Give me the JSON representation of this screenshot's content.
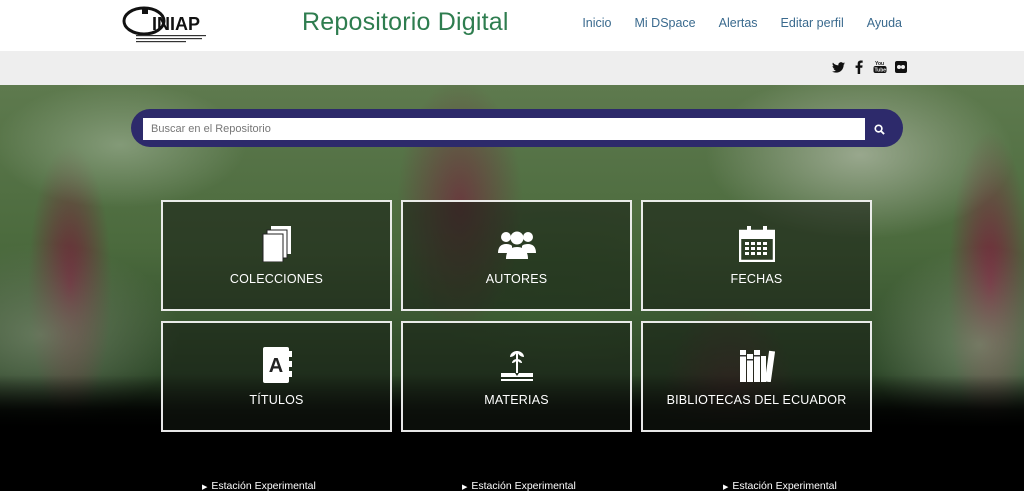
{
  "header": {
    "logo_text": "INIAP",
    "logo_subtitle": "INSTITUTO NACIONAL DE INVESTIGACIONES AGROPECUARIAS",
    "site_title": "Repositorio Digital",
    "nav": [
      "Inicio",
      "Mi DSpace",
      "Alertas",
      "Editar perfil",
      "Ayuda"
    ]
  },
  "social": [
    "twitter-icon",
    "facebook-icon",
    "youtube-icon",
    "flickr-icon"
  ],
  "search": {
    "placeholder": "Buscar en el Repositorio",
    "value": ""
  },
  "tiles": [
    {
      "label": "COLECCIONES",
      "icon": "documents-icon"
    },
    {
      "label": "AUTORES",
      "icon": "users-icon"
    },
    {
      "label": "FECHAS",
      "icon": "calendar-icon"
    },
    {
      "label": "TÍTULOS",
      "icon": "address-book-icon"
    },
    {
      "label": "MATERIAS",
      "icon": "plant-book-icon"
    },
    {
      "label": "BIBLIOTECAS DEL ECUADOR",
      "icon": "library-books-icon"
    }
  ],
  "footer": [
    "Estación Experimental",
    "Estación Experimental",
    "Estación Experimental"
  ],
  "colors": {
    "title_green": "#2e7d4f",
    "search_navy": "#2d2a6b",
    "nav_blue": "#3a6a8e"
  }
}
